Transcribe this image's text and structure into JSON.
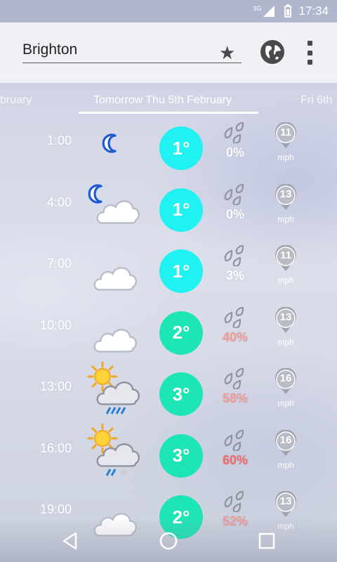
{
  "status_bar": {
    "network": "3G",
    "time": "17:34"
  },
  "search": {
    "value": "Brighton"
  },
  "icons": {
    "favorite": "star-icon",
    "location": "globe-icon",
    "overflow": "more-vert-icon"
  },
  "tabs": {
    "prev": "bruary",
    "current": "Tomorrow Thu 5th February",
    "next": "Fri 6th"
  },
  "rows": [
    {
      "time": "1:00",
      "condition": "clear-night",
      "temp": "1°",
      "temp_color": "#1ff2f0",
      "rain": "0%",
      "rain_level": "normal",
      "wind": "11",
      "unit": "mph"
    },
    {
      "time": "4:00",
      "condition": "cloudy-night",
      "temp": "1°",
      "temp_color": "#1ff2f0",
      "rain": "0%",
      "rain_level": "normal",
      "wind": "13",
      "unit": "mph"
    },
    {
      "time": "7:00",
      "condition": "cloud",
      "temp": "1°",
      "temp_color": "#1ff2f0",
      "rain": "3%",
      "rain_level": "normal",
      "wind": "11",
      "unit": "mph"
    },
    {
      "time": "10:00",
      "condition": "cloud",
      "temp": "2°",
      "temp_color": "#1ee5b4",
      "rain": "40%",
      "rain_level": "warm",
      "wind": "13",
      "unit": "mph"
    },
    {
      "time": "13:00",
      "condition": "sun-rain",
      "temp": "3°",
      "temp_color": "#1ee5b4",
      "rain": "58%",
      "rain_level": "warm",
      "wind": "16",
      "unit": "mph"
    },
    {
      "time": "16:00",
      "condition": "sun-sleet",
      "temp": "3°",
      "temp_color": "#1ee5b4",
      "rain": "60%",
      "rain_level": "hot",
      "wind": "16",
      "unit": "mph"
    },
    {
      "time": "19:00",
      "condition": "cloud",
      "temp": "2°",
      "temp_color": "#1ee5b4",
      "rain": "52%",
      "rain_level": "warm",
      "wind": "13",
      "unit": "mph"
    }
  ],
  "navbar": {
    "back": "back-icon",
    "home": "home-icon",
    "recents": "recents-icon"
  }
}
